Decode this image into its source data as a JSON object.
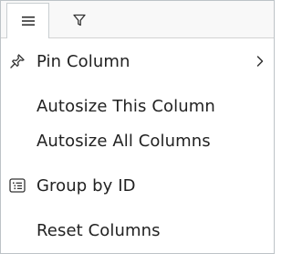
{
  "tabs": {
    "general_icon": "hamburger-icon",
    "filter_icon": "funnel-icon"
  },
  "items": [
    {
      "label": "Pin Column",
      "icon": "pin-icon",
      "has_submenu": true
    },
    {
      "label": "Autosize This Column"
    },
    {
      "label": "Autosize All Columns"
    },
    {
      "label": "Group by ID",
      "icon": "group-list-icon"
    },
    {
      "label": "Reset Columns"
    }
  ],
  "colors": {
    "border": "#bdc3c7",
    "tab_strip": "#f8f8f8",
    "text": "#222222",
    "icon": "#333333"
  }
}
